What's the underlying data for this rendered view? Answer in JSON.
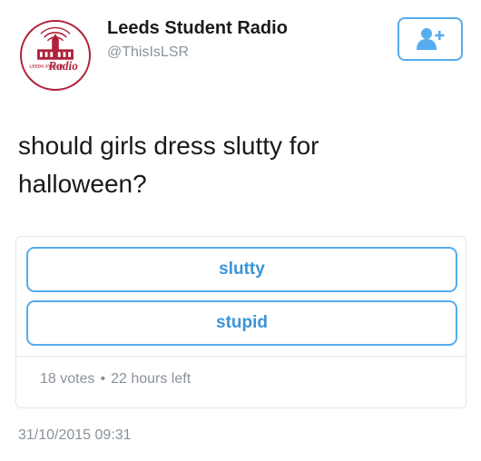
{
  "account": {
    "display_name": "Leeds Student Radio",
    "handle": "@ThisIsLSR",
    "avatar_logo_text": "Radio",
    "avatar_small_text": "LEEDS STUDENT",
    "follow_icon": "add-user-icon"
  },
  "tweet": {
    "text": "should girls dress slutty for halloween?"
  },
  "poll": {
    "choices": [
      {
        "label": "slutty"
      },
      {
        "label": "stupid"
      }
    ],
    "votes": "18 votes",
    "separator": "•",
    "time_left": "22 hours left"
  },
  "timestamp": "31/10/2015 09:31",
  "colors": {
    "accent": "#55acee",
    "choice_text": "#3b94d9",
    "muted": "#8a9299",
    "avatar_brand": "#b0203a"
  }
}
